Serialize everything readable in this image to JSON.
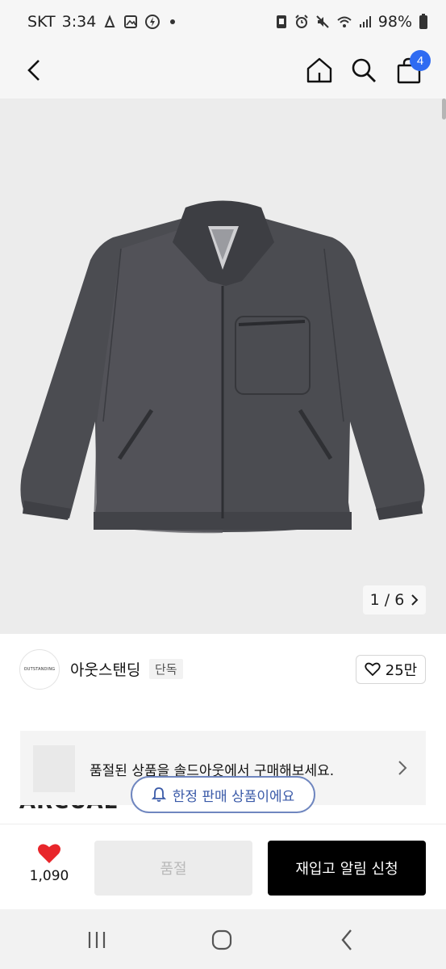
{
  "status_bar": {
    "carrier": "SKT",
    "time": "3:34",
    "battery": "98%"
  },
  "nav": {
    "cart_count": "4"
  },
  "product": {
    "image_pager": "1 / 6",
    "image_subject": "jacket-photo"
  },
  "brand": {
    "logo_text": "OUTSTANDING",
    "name": "아웃스탠딩",
    "tag": "단독",
    "like_count": "25만"
  },
  "underlying": {
    "product_name_partial": "ARCUAL"
  },
  "soldout_banner": {
    "text": "품절된 상품을 솔드아웃에서 구매해보세요."
  },
  "limited_pill": {
    "text": "한정 판매 상품이에요"
  },
  "action_bar": {
    "wish_count": "1,090",
    "soldout_label": "품절",
    "restock_label": "재입고 알림 신청"
  },
  "colors": {
    "accent_blue": "#2f6bf2",
    "heart_red": "#e8262b",
    "pill_border": "#6f86bf",
    "pill_text": "#3a5aa8"
  }
}
